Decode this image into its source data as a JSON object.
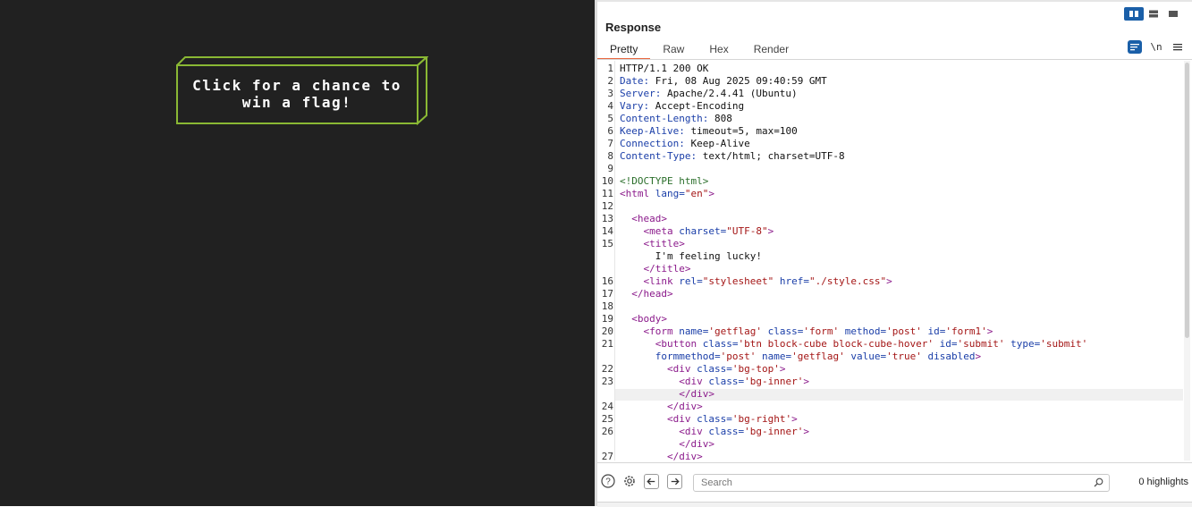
{
  "game": {
    "button_text": "Click for a chance to win a flag!"
  },
  "response": {
    "title": "Response",
    "tabs": [
      "Pretty",
      "Raw",
      "Hex",
      "Render"
    ],
    "active_tab": "Pretty",
    "tools": {
      "wrap_icon": "wrap-lines-icon",
      "newline_label": "\\n",
      "menu_icon": "hamburger-menu-icon"
    },
    "view_modes": [
      "split-vertical-icon",
      "split-horizontal-icon",
      "single-pane-icon"
    ],
    "search_placeholder": "Search",
    "highlights": "0 highlights"
  },
  "code_lines": [
    "1",
    "2",
    "3",
    "4",
    "5",
    "6",
    "7",
    "8",
    "9",
    "10",
    "11",
    "12",
    "13",
    "14",
    "15",
    "16",
    "17",
    "18",
    "19",
    "20",
    "21",
    "22",
    "23",
    "24",
    "25",
    "26",
    "27"
  ],
  "colors": {
    "left_bg": "#212121",
    "cube_green": "#8ab834",
    "accent_orange": "#e8663d",
    "accent_blue": "#1a5fa8"
  }
}
